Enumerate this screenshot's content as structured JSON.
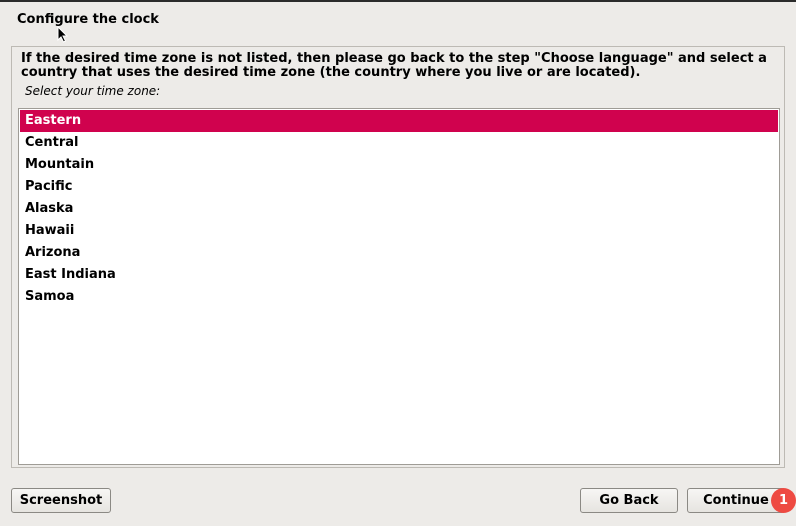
{
  "window": {
    "title": "Configure the clock"
  },
  "panel": {
    "description": "If the desired time zone is not listed, then please go back to the step \"Choose language\" and select a country that uses the desired time zone (the country where you live or are located).",
    "prompt": "Select your time zone:"
  },
  "timezones": {
    "selected": "Eastern",
    "items": [
      "Eastern",
      "Central",
      "Mountain",
      "Pacific",
      "Alaska",
      "Hawaii",
      "Arizona",
      "East Indiana",
      "Samoa"
    ]
  },
  "buttons": {
    "screenshot": "Screenshot",
    "go_back": "Go Back",
    "continue": "Continue"
  },
  "badge": {
    "count": "1"
  },
  "colors": {
    "selection": "#d0024e",
    "background": "#edebe8",
    "badge": "#ee4a42"
  },
  "icons": {
    "cursor": "mouse-pointer-icon"
  }
}
